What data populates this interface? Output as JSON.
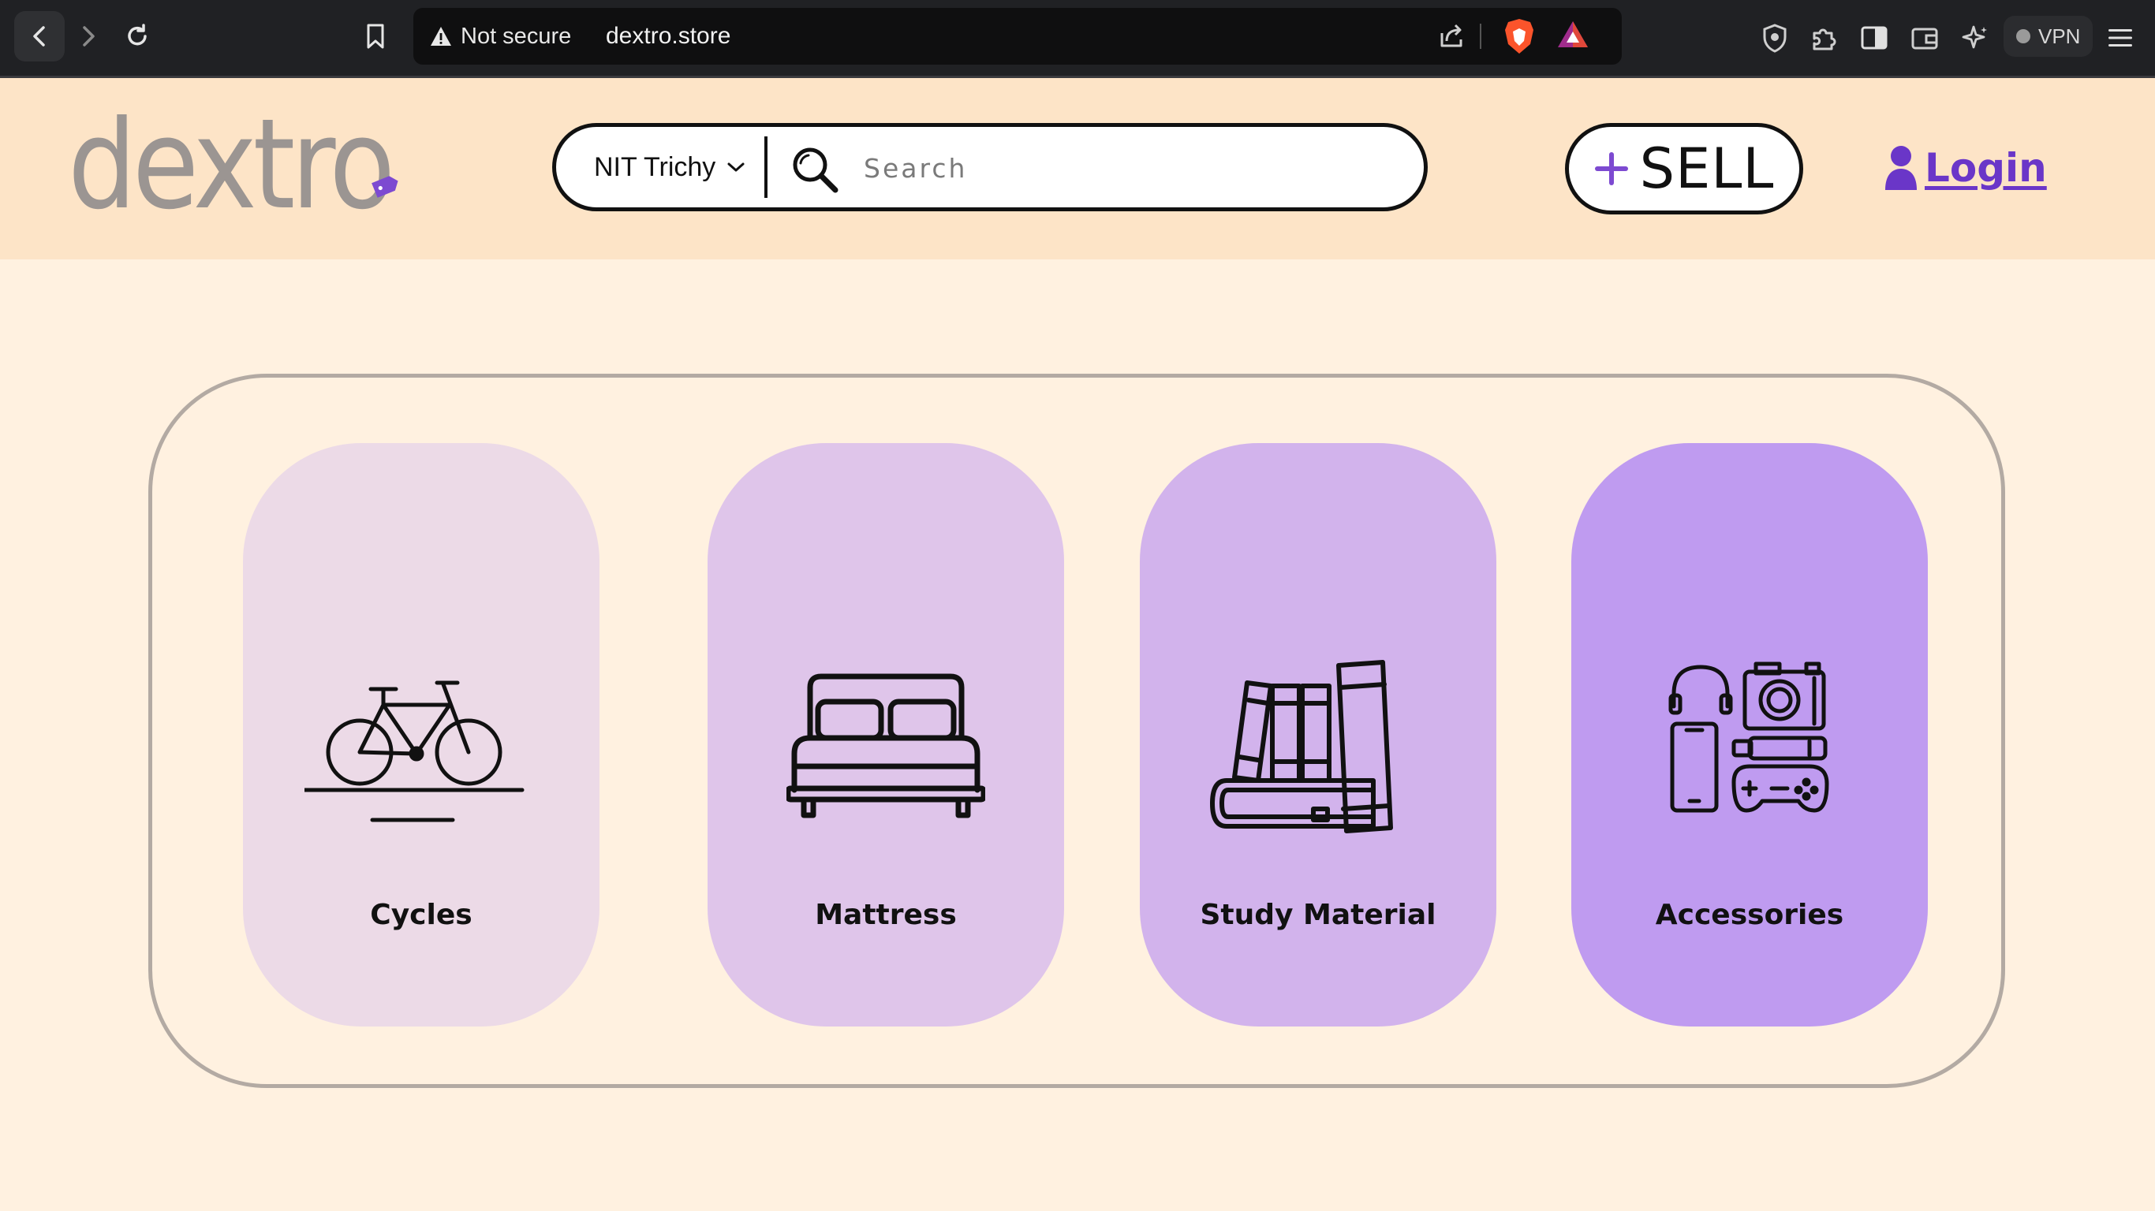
{
  "browser": {
    "security_label": "Not secure",
    "url": "dextro.store",
    "vpn_label": "VPN"
  },
  "header": {
    "logo_text": "dextro",
    "location": "NIT Trichy",
    "search_placeholder": "Search",
    "sell_label": "SELL",
    "login_label": "Login"
  },
  "categories": [
    {
      "label": "Cycles",
      "icon": "bicycle-icon"
    },
    {
      "label": "Mattress",
      "icon": "bed-icon"
    },
    {
      "label": "Study Material",
      "icon": "books-icon"
    },
    {
      "label": "Accessories",
      "icon": "gadgets-icon"
    }
  ],
  "colors": {
    "accent": "#6a36c8",
    "header_bg": "#fde4c7",
    "page_bg": "#fff1e0",
    "card_1": "#ecdae7",
    "card_2": "#dfc5ea",
    "card_3": "#d2b3ec",
    "card_4": "#bf9bf0"
  }
}
